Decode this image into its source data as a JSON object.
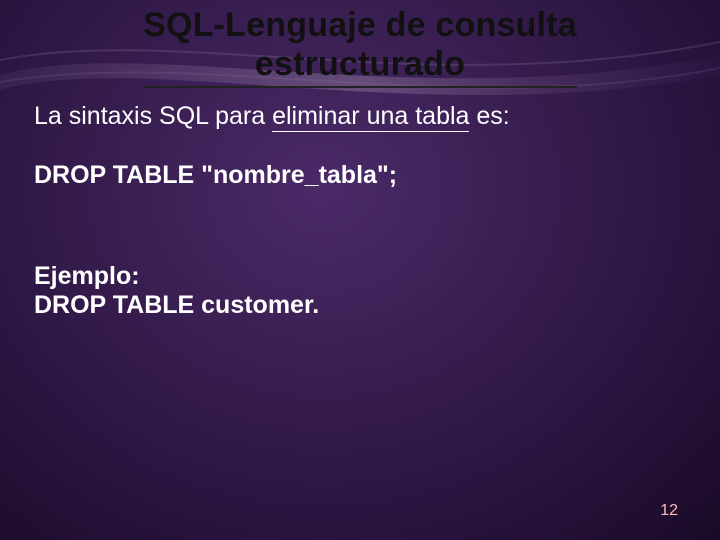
{
  "title_line1": "SQL-Lenguaje de consulta",
  "title_line2": "estructurado",
  "intro_prefix": "La sintaxis SQL para ",
  "intro_underlined": "eliminar una tabla",
  "intro_suffix": " es:",
  "syntax": "DROP TABLE \"nombre_tabla\";",
  "example_label": "Ejemplo:",
  "example_code": "DROP TABLE customer.",
  "page_number": "12"
}
